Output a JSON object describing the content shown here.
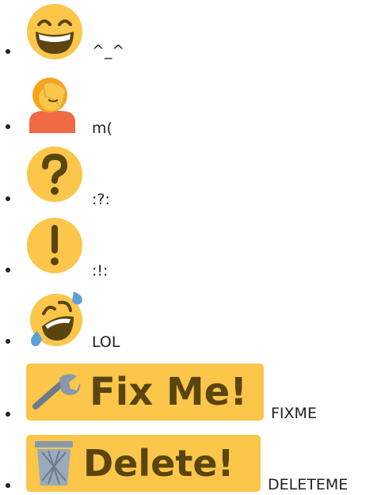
{
  "smileys": [
    {
      "icon": "grinning-face-icon",
      "text": "^_^"
    },
    {
      "icon": "facepalm-icon",
      "text": "m("
    },
    {
      "icon": "question-mark-icon",
      "text": ":?:"
    },
    {
      "icon": "exclamation-mark-icon",
      "text": ":!:"
    },
    {
      "icon": "rolling-on-floor-laughing-icon",
      "text": "LOL"
    },
    {
      "icon": "wrench-icon",
      "badge_text": "Fix Me!",
      "text": "FIXME"
    },
    {
      "icon": "wastebasket-icon",
      "badge_text": "Delete!",
      "text": "DELETEME"
    }
  ],
  "colors": {
    "emoji_yellow": "#fbc64a",
    "badge_text": "#5a4410",
    "text": "#222222"
  }
}
